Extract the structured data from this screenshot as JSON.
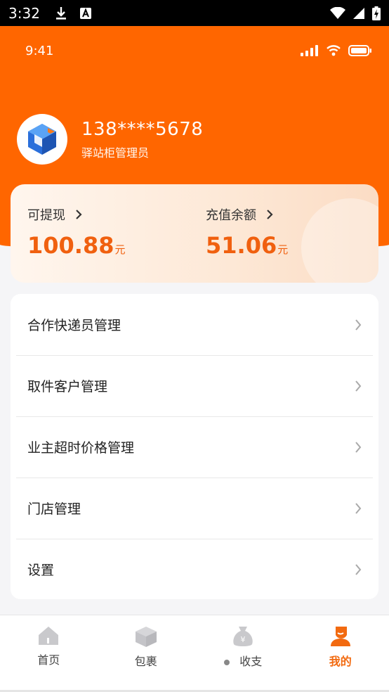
{
  "system_bar": {
    "time": "3:32"
  },
  "app_status": {
    "time": "9:41"
  },
  "profile": {
    "phone": "138****5678",
    "role": "驿站柜管理员"
  },
  "balance": {
    "withdrawable_label": "可提现",
    "withdrawable_amount": "100.88",
    "withdrawable_unit": "元",
    "recharge_label": "充值余额",
    "recharge_amount": "51.06",
    "recharge_unit": "元"
  },
  "menu": {
    "items": [
      {
        "label": "合作快递员管理"
      },
      {
        "label": "取件客户管理"
      },
      {
        "label": "业主超时价格管理"
      },
      {
        "label": "门店管理"
      },
      {
        "label": "设置"
      }
    ]
  },
  "tabbar": {
    "tabs": [
      {
        "label": "首页",
        "icon": "home-icon"
      },
      {
        "label": "包裹",
        "icon": "package-icon"
      },
      {
        "label": "收支",
        "icon": "money-bag-icon"
      },
      {
        "label": "我的",
        "icon": "profile-icon"
      }
    ],
    "active_index": 3
  },
  "colors": {
    "brand_orange": "#ff6600",
    "amount_orange": "#f0600f",
    "active_tab": "#f26a10"
  }
}
